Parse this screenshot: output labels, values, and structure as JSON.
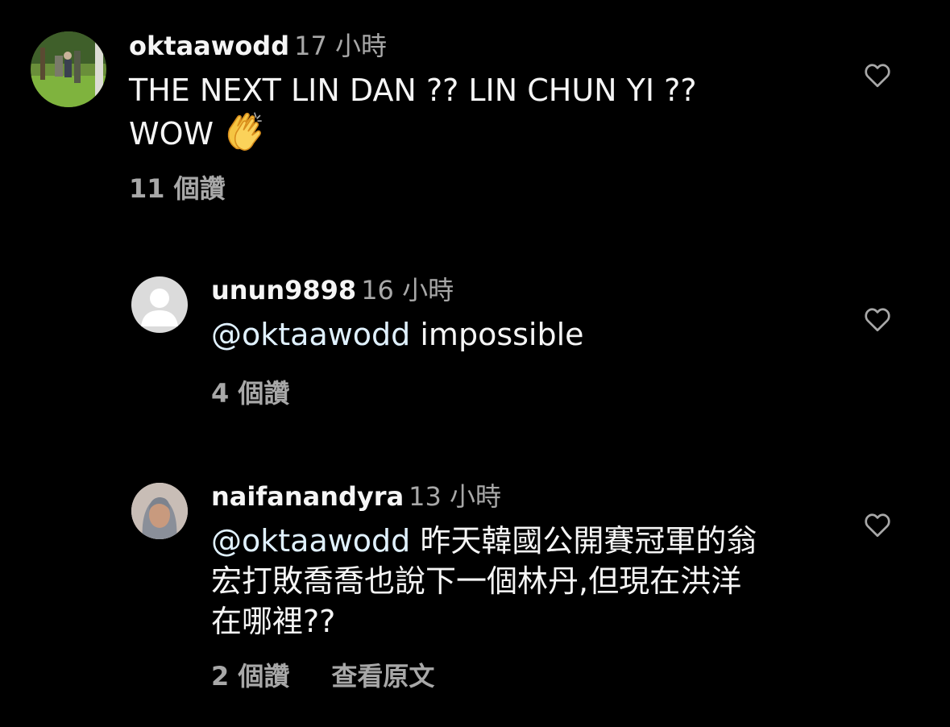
{
  "comments": [
    {
      "username": "oktaawodd",
      "time": "17 小時",
      "text_line1": "THE NEXT LIN DAN ?? LIN CHUN YI ??",
      "text_line2": "WOW",
      "emoji": "clapping-hands",
      "likes": "11 個讚",
      "avatar": "photo-avatar-outdoors"
    },
    {
      "username": "unun9898",
      "time": "16 小時",
      "mention": "@oktaawodd",
      "text": " impossible",
      "likes": "4 個讚",
      "avatar": "default-avatar"
    },
    {
      "username": "naifanandyra",
      "time": "13 小時",
      "mention": "@oktaawodd",
      "text_line1": " 昨天韓國公開賽冠軍的翁",
      "text_line2": "宏打敗喬喬也說下一個林丹,但現在洪洋",
      "text_line3": "在哪裡??",
      "likes": "2 個讚",
      "translate": "查看原文",
      "avatar": "photo-avatar-person"
    }
  ],
  "colors": {
    "background": "#000000",
    "primary_text": "#f5f5f5",
    "secondary_text": "#a8a8a8",
    "mention": "#e0f1ff"
  }
}
